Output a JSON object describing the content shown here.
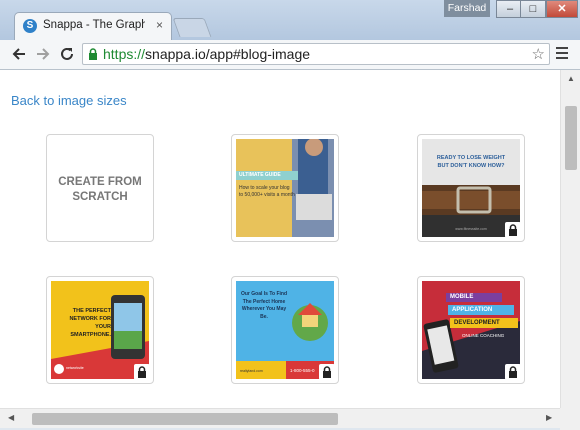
{
  "window": {
    "user": "Farshad",
    "min_label": "–",
    "max_label": "□",
    "close_label": "✕"
  },
  "tab": {
    "title": "Snappa - The Graphic Des",
    "favicon_letter": "S",
    "close_label": "×"
  },
  "toolbar": {
    "url_scheme": "https://",
    "url_rest": "snappa.io/app#blog-image",
    "star": "☆"
  },
  "page": {
    "back_link": "Back to image sizes",
    "scratch_line1": "CREATE FROM",
    "scratch_line2": "SCRATCH"
  },
  "templates": [
    {
      "name": "ultimate-guide",
      "banner": "ULTIMATE GUIDE",
      "text": "How to scale your blog to 50,000+ visits a month",
      "locked": false
    },
    {
      "name": "lose-weight",
      "line1": "READY TO LOSE WEIGHT",
      "line2": "BUT DON'T KNOW HOW?",
      "footer": "www.fitnesssite.com",
      "locked": true
    },
    {
      "name": "smartphone-network",
      "text": "THE PERFECT NETWORK FOR YOUR SMARTPHONE.",
      "brand": "networksite",
      "locked": true
    },
    {
      "name": "perfect-home",
      "text": "Our Goal Is To Find The Perfect Home Wherever You May Be.",
      "brand": "realtyland.com",
      "phone": "1-800-555-0",
      "locked": true
    },
    {
      "name": "mobile-app",
      "line1": "MOBILE",
      "line2": "APPLICATION",
      "line3": "DEVELOPMENT",
      "line4": "ONLINE COACHING",
      "locked": true
    }
  ],
  "colors": {
    "link": "#3a86c8",
    "https_green": "#1e8a32",
    "guide_yellow": "#e8c25a",
    "weight_blue": "#2c5f9a",
    "phone_yellow": "#f2c21b",
    "home_blue": "#4fb3e6",
    "app_red": "#c62d3a"
  }
}
